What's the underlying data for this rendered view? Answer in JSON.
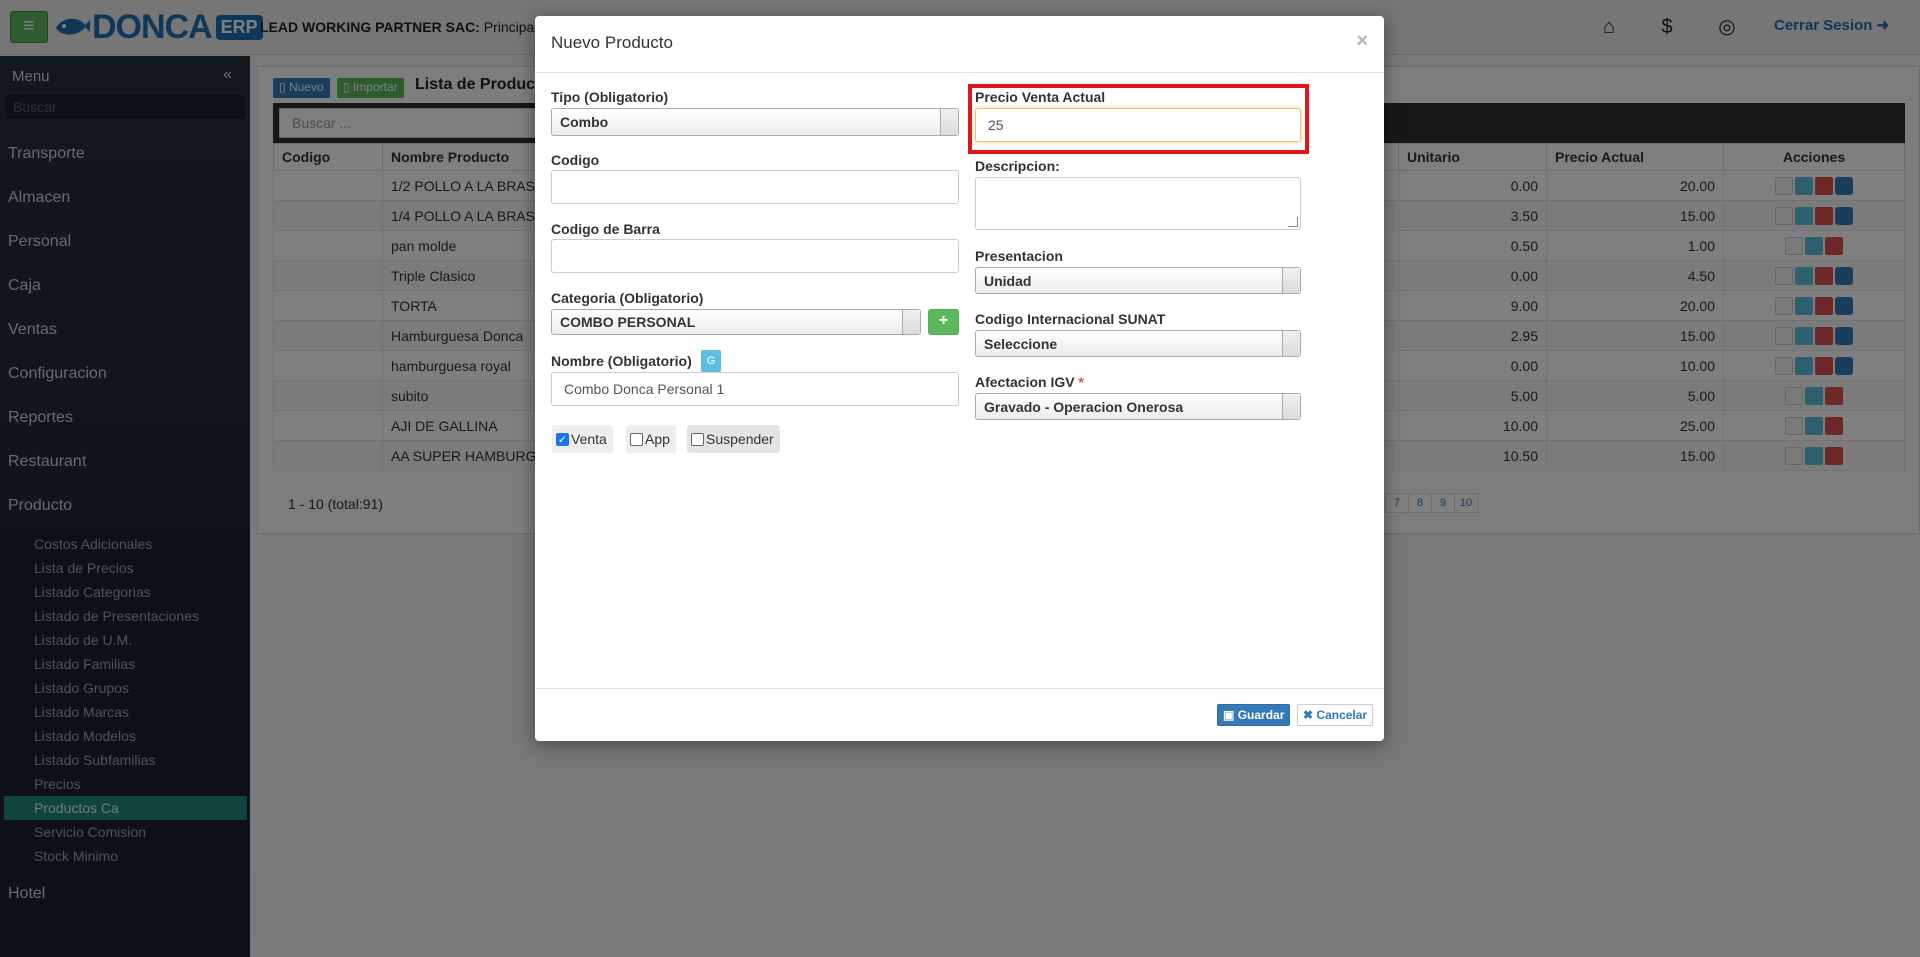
{
  "topbar": {
    "logo_text": "DONCA",
    "logo_badge": "ERP",
    "company_label": "LEAD WORKING PARTNER SAC:",
    "company_branch": "Principal",
    "home_icon": "home-icon",
    "money_icon": "dollar-icon",
    "lock_icon": "lock-icon",
    "logout_label": "Cerrar Sesion"
  },
  "sidebar": {
    "title": "Menu",
    "search_placeholder": "Buscar",
    "categories": [
      "Transporte",
      "Almacen",
      "Personal",
      "Caja",
      "Ventas",
      "Configuracion",
      "Reportes",
      "Restaurant",
      "Producto"
    ],
    "sub_items": [
      "Costos Adicionales",
      "Lista de Precios",
      "Listado Categorias",
      "Listado de Presentaciones",
      "Listado de U.M.",
      "Listado Familias",
      "Listado Grupos",
      "Listado Marcas",
      "Listado Modelos",
      "Listado Subfamilias",
      "Precios",
      "Productos Ca",
      "Servicio Comision",
      "Stock Minimo"
    ],
    "last_category": "Hotel"
  },
  "list": {
    "new_button": "Nuevo",
    "import_button": "Importar",
    "title": "Lista de Produc",
    "search_placeholder": "Buscar ...",
    "columns": [
      "Codigo",
      "Nombre Producto",
      "Unitario",
      "Precio Actual",
      "Acciones"
    ],
    "rows": [
      {
        "code": "",
        "name": "1/2 POLLO A LA BRAS",
        "unit": "0.00",
        "price": "20.00"
      },
      {
        "code": "",
        "name": "1/4 POLLO A LA BRAS",
        "unit": "3.50",
        "price": "15.00"
      },
      {
        "code": "",
        "name": "pan molde",
        "unit": "0.50",
        "price": "1.00"
      },
      {
        "code": "",
        "name": "Triple Clasico",
        "unit": "0.00",
        "price": "4.50"
      },
      {
        "code": "",
        "name": "TORTA",
        "unit": "9.00",
        "price": "20.00"
      },
      {
        "code": "",
        "name": "Hamburguesa Donca",
        "unit": "2.95",
        "price": "15.00"
      },
      {
        "code": "",
        "name": "hamburguesa royal",
        "unit": "0.00",
        "price": "10.00"
      },
      {
        "code": "",
        "name": "subito",
        "unit": "5.00",
        "price": "5.00"
      },
      {
        "code": "",
        "name": "AJI DE GALLINA",
        "unit": "10.00",
        "price": "25.00"
      },
      {
        "code": "",
        "name": "AA SUPER HAMBURGE",
        "unit": "10.50",
        "price": "15.00"
      }
    ],
    "pager_info": "1 - 10 (total:91)",
    "pages": [
      "7",
      "8",
      "9",
      "10"
    ]
  },
  "modal": {
    "title": "Nuevo Producto",
    "close": "×",
    "tipo_label": "Tipo (Obligatorio)",
    "tipo_value": "Combo",
    "codigo_label": "Codigo",
    "codigo_value": "",
    "barra_label": "Codigo de Barra",
    "barra_value": "",
    "categoria_label": "Categoria (Obligatorio)",
    "categoria_value": "COMBO PERSONAL",
    "nombre_label": "Nombre (Obligatorio)",
    "nombre_badge": "G",
    "nombre_value": "Combo Donca Personal 1",
    "chk_venta": "Venta",
    "chk_app": "App",
    "chk_suspender": "Suspender",
    "precio_label": "Precio Venta Actual",
    "precio_value": "25",
    "descripcion_label": "Descripcion:",
    "presentacion_label": "Presentacion",
    "presentacion_value": "Unidad",
    "sunat_label": "Codigo Internacional SUNAT",
    "sunat_value": "Seleccione",
    "igv_label": "Afectacion IGV",
    "igv_required": "*",
    "igv_value": "Gravado - Operacion Onerosa",
    "save_label": "Guardar",
    "cancel_label": "Cancelar",
    "highlight_color": "#e0161e"
  }
}
